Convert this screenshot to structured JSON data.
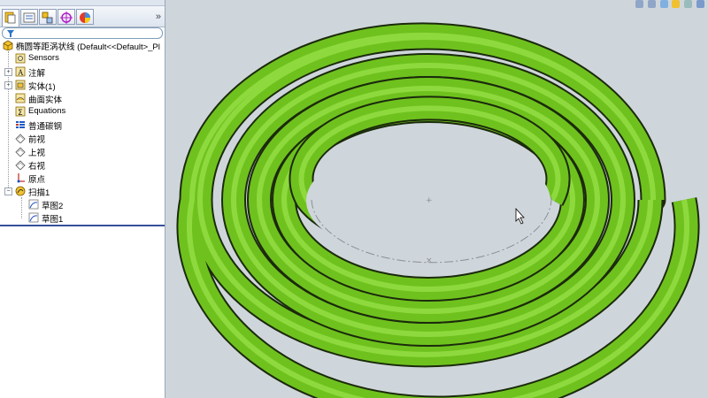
{
  "panel": {
    "tabs": [
      {
        "name": "featuremanager-tab",
        "icon": "feature-tree-icon"
      },
      {
        "name": "propertymanager-tab",
        "icon": "property-icon"
      },
      {
        "name": "configurationmanager-tab",
        "icon": "configuration-icon"
      },
      {
        "name": "dimxpert-tab",
        "icon": "dimxpert-icon"
      },
      {
        "name": "display-manager-tab",
        "icon": "appearance-icon"
      }
    ],
    "overflow_label": "»"
  },
  "tree": {
    "root": "椭圆等距涡状线  (Default<<Default>_Pl",
    "items": [
      {
        "label": "Sensors",
        "icon": "sensors-icon"
      },
      {
        "label": "注解",
        "icon": "annotations-icon"
      },
      {
        "label": "实体(1)",
        "icon": "solid-bodies-icon"
      },
      {
        "label": "曲面实体",
        "icon": "surface-bodies-icon"
      },
      {
        "label": "Equations",
        "icon": "equations-icon"
      },
      {
        "label": "普通碳钢",
        "icon": "material-icon"
      },
      {
        "label": "前视",
        "icon": "plane-icon"
      },
      {
        "label": "上视",
        "icon": "plane-icon"
      },
      {
        "label": "右视",
        "icon": "plane-icon"
      },
      {
        "label": "原点",
        "icon": "origin-icon"
      },
      {
        "label": "扫描1",
        "icon": "sweep-icon"
      },
      {
        "label": "草图2",
        "icon": "sketch-icon"
      },
      {
        "label": "草图1",
        "icon": "sketch-icon"
      }
    ]
  },
  "viewport": {
    "background": "#cfd6db",
    "model_color": "#6fc21e",
    "toolbar_icons": [
      "zoom-to-fit-icon",
      "zoom-area-icon",
      "previous-view-icon",
      "section-view-icon",
      "view-orientation-icon",
      "display-style-icon"
    ]
  }
}
